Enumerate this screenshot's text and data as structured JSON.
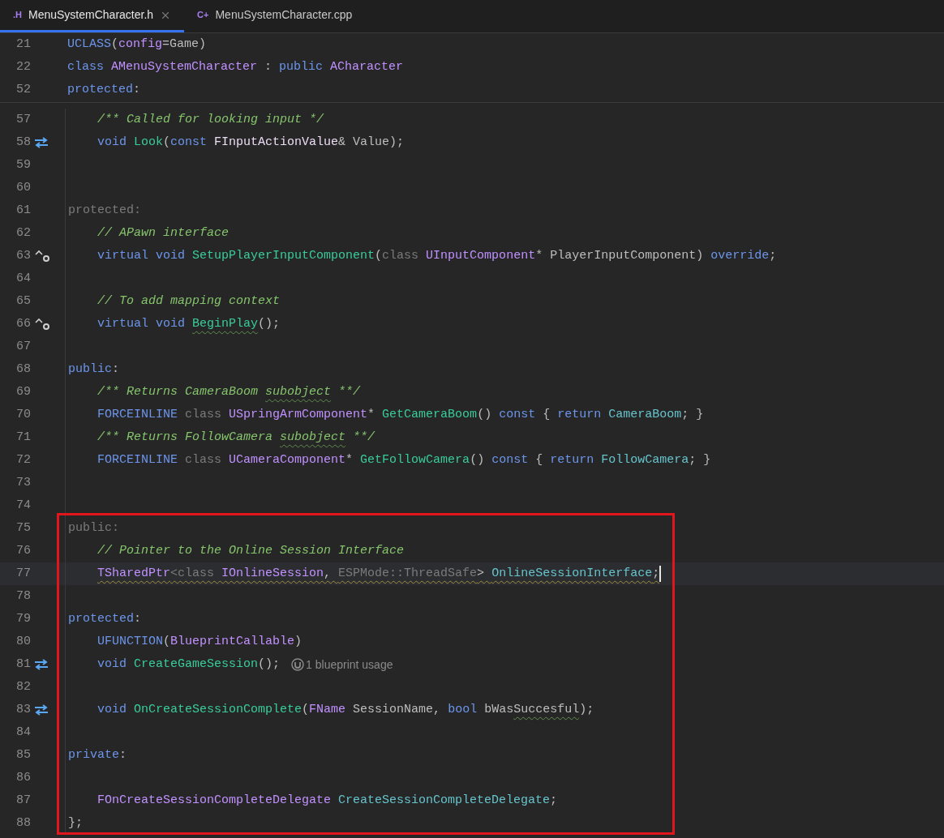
{
  "tabs": [
    {
      "badge": ".H",
      "label": "MenuSystemCharacter.h",
      "selected": true
    },
    {
      "badge": "C+",
      "label": "MenuSystemCharacter.cpp",
      "selected": false
    }
  ],
  "sticky_lines": [
    {
      "number": "21",
      "tokens": [
        {
          "text": "UCLASS",
          "kind": "macro"
        },
        {
          "text": "(",
          "kind": "plain"
        },
        {
          "text": "config",
          "kind": "type"
        },
        {
          "text": "=Game)",
          "kind": "plain"
        }
      ]
    },
    {
      "number": "22",
      "tokens": [
        {
          "text": "class ",
          "kind": "kw"
        },
        {
          "text": "AMenuSystemCharacter",
          "kind": "type"
        },
        {
          "text": " : ",
          "kind": "plain"
        },
        {
          "text": "public ",
          "kind": "kw"
        },
        {
          "text": "ACharacter",
          "kind": "type"
        }
      ]
    },
    {
      "number": "52",
      "tokens": [
        {
          "text": "protected",
          "kind": "kw"
        },
        {
          "text": ":",
          "kind": "plain"
        }
      ]
    }
  ],
  "lines": [
    {
      "number": "57",
      "indented": true,
      "tokens": [
        {
          "text": "/** Called for looking input */",
          "kind": "cmt"
        }
      ]
    },
    {
      "number": "58",
      "gutter": {
        "kind": "implemented"
      },
      "indented": true,
      "tokens": [
        {
          "text": "void ",
          "kind": "kw"
        },
        {
          "text": "Look",
          "kind": "fn"
        },
        {
          "text": "(",
          "kind": "plain"
        },
        {
          "text": "const ",
          "kind": "kw"
        },
        {
          "text": "FInputActionValue",
          "kind": "struct"
        },
        {
          "text": "& Value);",
          "kind": "plain"
        }
      ]
    },
    {
      "number": "59"
    },
    {
      "number": "60"
    },
    {
      "number": "61",
      "tokens": [
        {
          "text": "protected:",
          "kind": "dim"
        }
      ]
    },
    {
      "number": "62",
      "indented": true,
      "tokens": [
        {
          "text": "// APawn interface",
          "kind": "cmt"
        }
      ]
    },
    {
      "number": "63",
      "gutter": {
        "kind": "overrides"
      },
      "indented": true,
      "tokens": [
        {
          "text": "virtual ",
          "kind": "kw"
        },
        {
          "text": "void ",
          "kind": "kw"
        },
        {
          "text": "SetupPlayerInputComponent",
          "kind": "fn"
        },
        {
          "text": "(",
          "kind": "plain"
        },
        {
          "text": "class ",
          "kind": "dim"
        },
        {
          "text": "UInputComponent",
          "kind": "type"
        },
        {
          "text": "* PlayerInputComponent) ",
          "kind": "plain"
        },
        {
          "text": "override",
          "kind": "kw"
        },
        {
          "text": ";",
          "kind": "plain"
        }
      ]
    },
    {
      "number": "64"
    },
    {
      "number": "65",
      "indented": true,
      "tokens": [
        {
          "text": "// To add mapping context",
          "kind": "cmt"
        }
      ]
    },
    {
      "number": "66",
      "gutter": {
        "kind": "overrides"
      },
      "indented": true,
      "tokens": [
        {
          "text": "virtual ",
          "kind": "kw"
        },
        {
          "text": "void ",
          "kind": "kw"
        },
        {
          "text": "BeginPlay",
          "kind": "fn",
          "squiggle": {
            "kind": "typo"
          }
        },
        {
          "text": "();",
          "kind": "plain"
        }
      ]
    },
    {
      "number": "67"
    },
    {
      "number": "68",
      "tokens": [
        {
          "text": "public",
          "kind": "kw"
        },
        {
          "text": ":",
          "kind": "plain"
        }
      ]
    },
    {
      "number": "69",
      "indented": true,
      "tokens": [
        {
          "text": "/** Returns CameraBoom ",
          "kind": "cmt"
        },
        {
          "text": "subobject",
          "kind": "cmt",
          "squiggle": {
            "kind": "typo"
          }
        },
        {
          "text": " **/",
          "kind": "cmt"
        }
      ]
    },
    {
      "number": "70",
      "indented": true,
      "tokens": [
        {
          "text": "FORCEINLINE",
          "kind": "macro"
        },
        {
          "text": " class ",
          "kind": "dim"
        },
        {
          "text": "USpringArmComponent",
          "kind": "type"
        },
        {
          "text": "* ",
          "kind": "plain"
        },
        {
          "text": "GetCameraBoom",
          "kind": "fn"
        },
        {
          "text": "() ",
          "kind": "plain"
        },
        {
          "text": "const",
          "kind": "kw"
        },
        {
          "text": " { ",
          "kind": "plain"
        },
        {
          "text": "return ",
          "kind": "kw"
        },
        {
          "text": "CameraBoom",
          "kind": "field"
        },
        {
          "text": "; }",
          "kind": "plain"
        }
      ]
    },
    {
      "number": "71",
      "indented": true,
      "tokens": [
        {
          "text": "/** Returns FollowCamera ",
          "kind": "cmt"
        },
        {
          "text": "subobject",
          "kind": "cmt",
          "squiggle": {
            "kind": "typo"
          }
        },
        {
          "text": " **/",
          "kind": "cmt"
        }
      ]
    },
    {
      "number": "72",
      "indented": true,
      "tokens": [
        {
          "text": "FORCEINLINE",
          "kind": "macro"
        },
        {
          "text": " class ",
          "kind": "dim"
        },
        {
          "text": "UCameraComponent",
          "kind": "type"
        },
        {
          "text": "* ",
          "kind": "plain"
        },
        {
          "text": "GetFollowCamera",
          "kind": "fn"
        },
        {
          "text": "() ",
          "kind": "plain"
        },
        {
          "text": "const",
          "kind": "kw"
        },
        {
          "text": " { ",
          "kind": "plain"
        },
        {
          "text": "return ",
          "kind": "kw"
        },
        {
          "text": "FollowCamera",
          "kind": "field"
        },
        {
          "text": "; }",
          "kind": "plain"
        }
      ]
    },
    {
      "number": "73"
    },
    {
      "number": "74"
    },
    {
      "number": "75",
      "boxed": true,
      "tokens": [
        {
          "text": "public:",
          "kind": "dim"
        }
      ]
    },
    {
      "number": "76",
      "boxed": true,
      "indented": true,
      "tokens": [
        {
          "text": "// Pointer to the Online Session Interface",
          "kind": "cmt"
        }
      ]
    },
    {
      "number": "77",
      "boxed": true,
      "indented": true,
      "current": true,
      "caret": true,
      "tokens": [
        {
          "text": "TSharedPtr",
          "kind": "type",
          "squiggle": {
            "kind": "warn"
          }
        },
        {
          "text": "<class ",
          "kind": "dim",
          "squiggle": {
            "kind": "warn"
          }
        },
        {
          "text": "IOnlineSession",
          "kind": "type",
          "squiggle": {
            "kind": "warn"
          }
        },
        {
          "text": ", ",
          "kind": "plain",
          "squiggle": {
            "kind": "warn"
          }
        },
        {
          "text": "ESPMode::ThreadSafe",
          "kind": "dim",
          "squiggle": {
            "kind": "warn"
          }
        },
        {
          "text": "> ",
          "kind": "plain",
          "squiggle": {
            "kind": "warn"
          }
        },
        {
          "text": "OnlineSessionInterface",
          "kind": "field",
          "squiggle": {
            "kind": "warn"
          }
        },
        {
          "text": ";",
          "kind": "plain",
          "squiggle": {
            "kind": "warn"
          }
        }
      ]
    },
    {
      "number": "78",
      "boxed": true
    },
    {
      "number": "79",
      "boxed": true,
      "tokens": [
        {
          "text": "protected",
          "kind": "kw"
        },
        {
          "text": ":",
          "kind": "plain"
        }
      ]
    },
    {
      "number": "80",
      "boxed": true,
      "indented": true,
      "tokens": [
        {
          "text": "UFUNCTION",
          "kind": "macro"
        },
        {
          "text": "(",
          "kind": "plain"
        },
        {
          "text": "BlueprintCallable",
          "kind": "type"
        },
        {
          "text": ")",
          "kind": "plain"
        }
      ]
    },
    {
      "number": "81",
      "boxed": true,
      "gutter": {
        "kind": "implemented"
      },
      "indented": true,
      "hint": "1 blueprint usage",
      "tokens": [
        {
          "text": "void ",
          "kind": "kw"
        },
        {
          "text": "CreateGameSession",
          "kind": "fn"
        },
        {
          "text": "();",
          "kind": "plain"
        }
      ]
    },
    {
      "number": "82",
      "boxed": true
    },
    {
      "number": "83",
      "boxed": true,
      "gutter": {
        "kind": "implemented"
      },
      "indented": true,
      "tokens": [
        {
          "text": "void ",
          "kind": "kw"
        },
        {
          "text": "OnCreateSessionComplete",
          "kind": "fn"
        },
        {
          "text": "(",
          "kind": "plain"
        },
        {
          "text": "FName",
          "kind": "type"
        },
        {
          "text": " SessionName, ",
          "kind": "plain"
        },
        {
          "text": "bool ",
          "kind": "kw"
        },
        {
          "text": "bWas",
          "kind": "plain"
        },
        {
          "text": "Succesful",
          "kind": "plain",
          "squiggle": {
            "kind": "typo"
          }
        },
        {
          "text": ");",
          "kind": "plain"
        }
      ]
    },
    {
      "number": "84",
      "boxed": true
    },
    {
      "number": "85",
      "boxed": true,
      "tokens": [
        {
          "text": "private",
          "kind": "kw"
        },
        {
          "text": ":",
          "kind": "plain"
        }
      ]
    },
    {
      "number": "86",
      "boxed": true
    },
    {
      "number": "87",
      "boxed": true,
      "indented": true,
      "tokens": [
        {
          "text": "FOnCreateSessionCompleteDelegate ",
          "kind": "type"
        },
        {
          "text": "CreateSessionCompleteDelegate",
          "kind": "field"
        },
        {
          "text": ";",
          "kind": "plain"
        }
      ]
    },
    {
      "number": "88",
      "boxed": true,
      "tokens": [
        {
          "text": "};",
          "kind": "plain"
        }
      ]
    }
  ]
}
